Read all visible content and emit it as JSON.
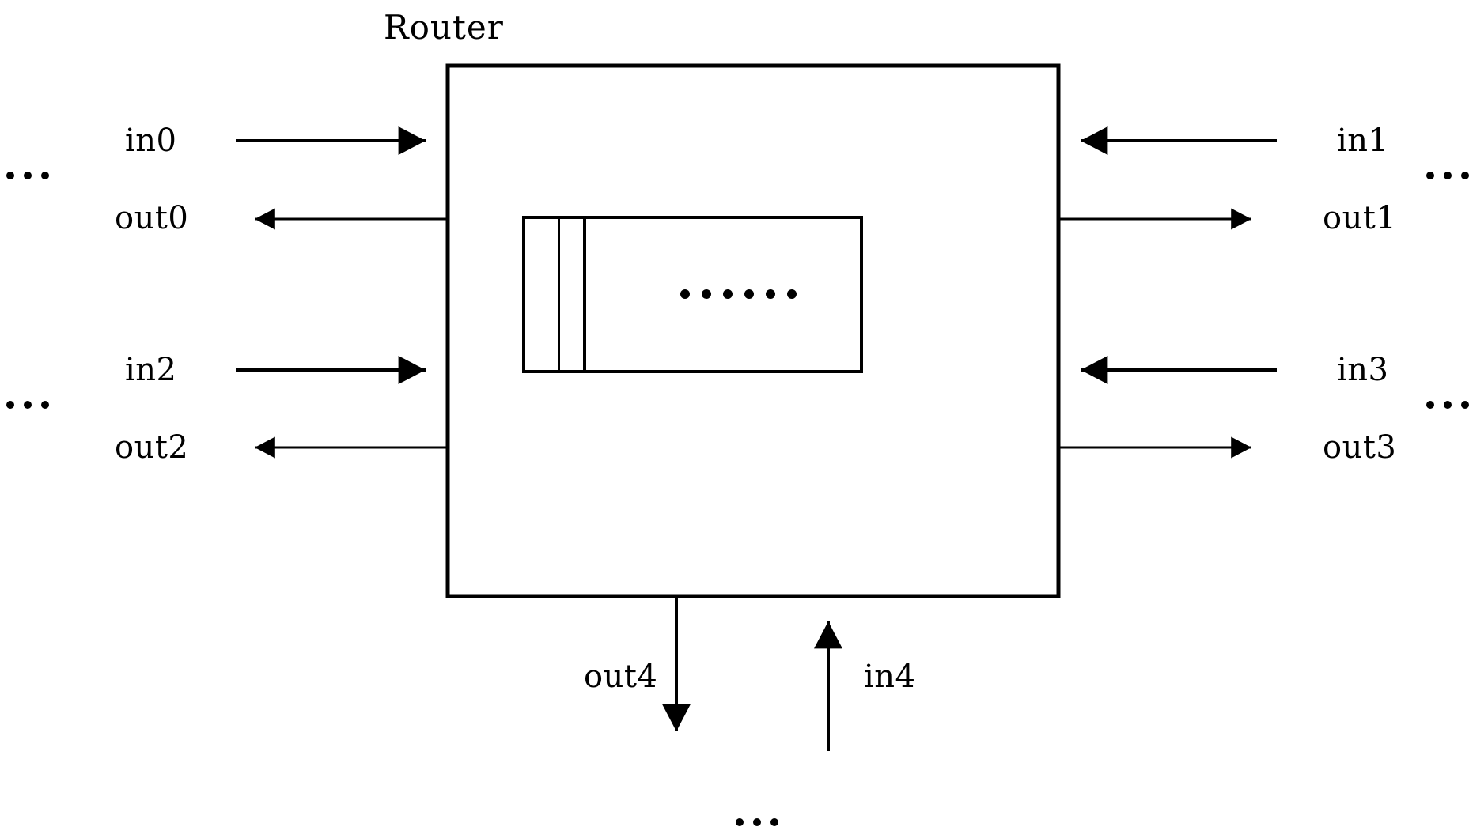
{
  "figure": {
    "title": "Router",
    "kind": "block-diagram",
    "background_color": "#ffffff",
    "stroke_color": "#000000"
  },
  "router": {
    "label": "Router",
    "inner_block": {
      "name": "buffer-queue",
      "ellipsis": "......",
      "slot_count_visible": 2
    }
  },
  "ports": {
    "west": [
      {
        "id": "in0",
        "label": "in0",
        "direction": "input"
      },
      {
        "id": "out0",
        "label": "out0",
        "direction": "output"
      },
      {
        "id": "in2",
        "label": "in2",
        "direction": "input"
      },
      {
        "id": "out2",
        "label": "out2",
        "direction": "output"
      }
    ],
    "east": [
      {
        "id": "in1",
        "label": "in1",
        "direction": "input"
      },
      {
        "id": "out1",
        "label": "out1",
        "direction": "output"
      },
      {
        "id": "in3",
        "label": "in3",
        "direction": "input"
      },
      {
        "id": "out3",
        "label": "out3",
        "direction": "output"
      }
    ],
    "south": [
      {
        "id": "out4",
        "label": "out4",
        "direction": "output"
      },
      {
        "id": "in4",
        "label": "in4",
        "direction": "input"
      }
    ]
  },
  "ellipses": {
    "west_top": "...",
    "west_bottom": "...",
    "east_top": "...",
    "east_bottom": "...",
    "south": "..."
  }
}
